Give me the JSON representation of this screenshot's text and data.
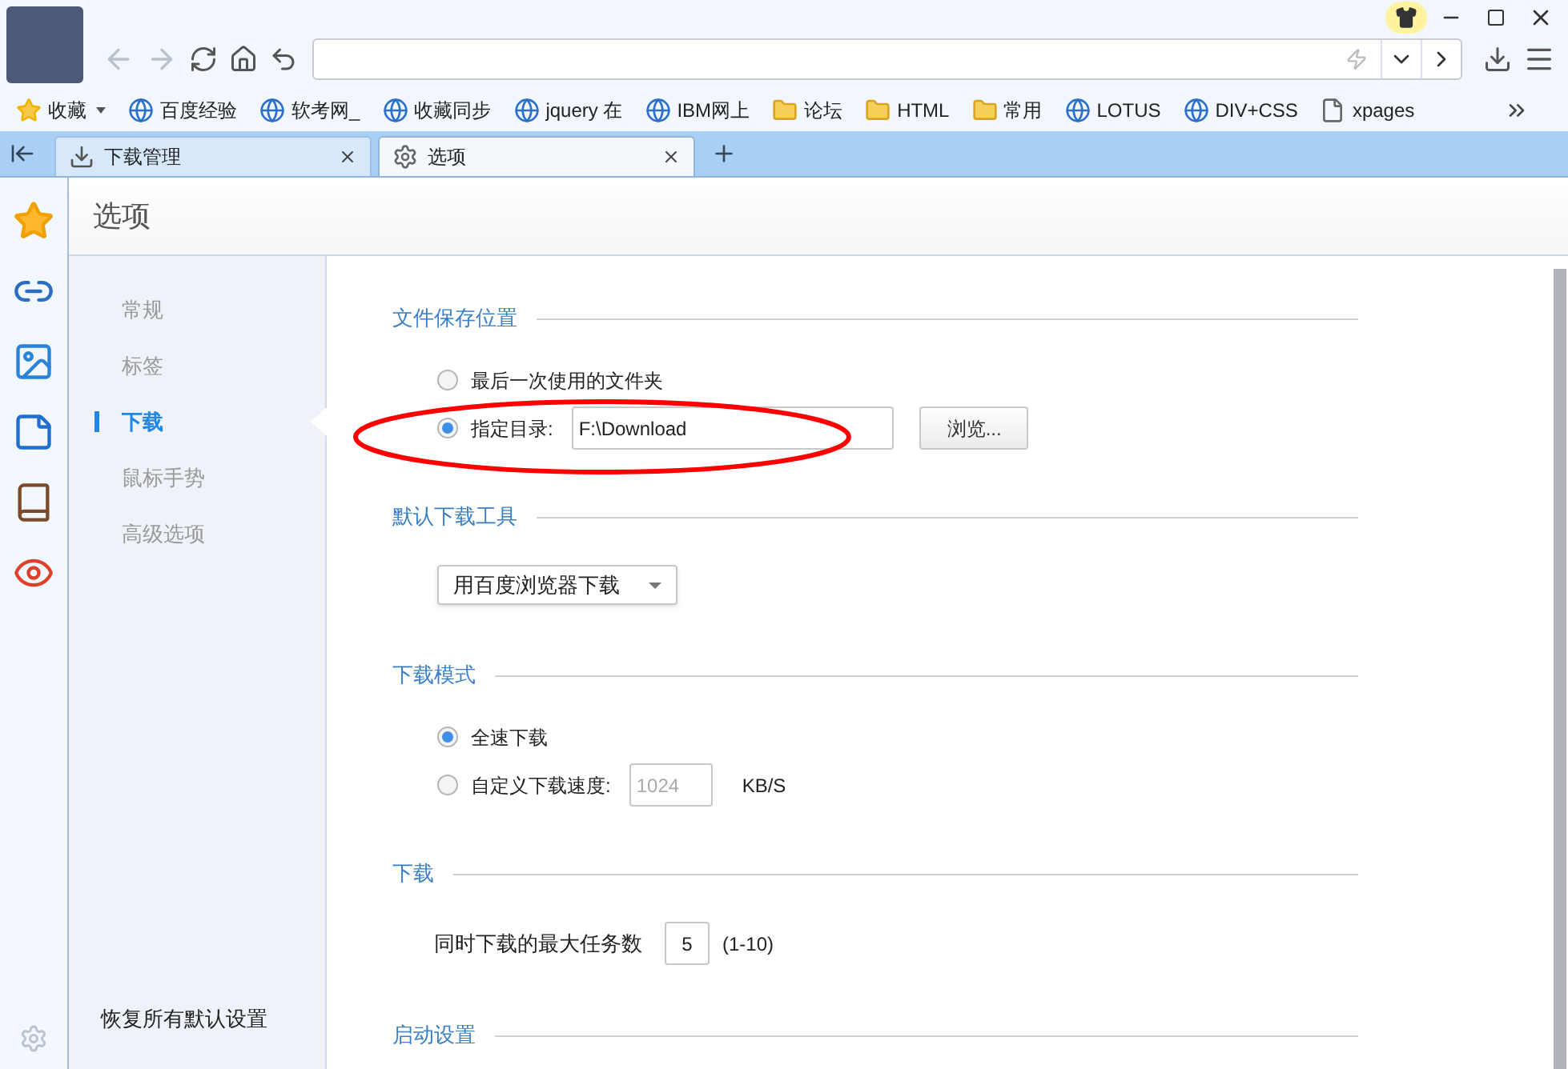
{
  "bookmarks": [
    {
      "label": "收藏",
      "kind": "menu"
    },
    {
      "label": "百度经验",
      "kind": "site"
    },
    {
      "label": "软考网_",
      "kind": "site"
    },
    {
      "label": "收藏同步",
      "kind": "site"
    },
    {
      "label": "jquery 在",
      "kind": "site"
    },
    {
      "label": "IBM网上",
      "kind": "site"
    },
    {
      "label": "论坛",
      "kind": "folder"
    },
    {
      "label": "HTML",
      "kind": "folder"
    },
    {
      "label": "常用",
      "kind": "folder"
    },
    {
      "label": "LOTUS",
      "kind": "site"
    },
    {
      "label": "DIV+CSS",
      "kind": "site"
    },
    {
      "label": "xpages",
      "kind": "page"
    }
  ],
  "tabs": [
    {
      "label": "下载管理",
      "selected": false
    },
    {
      "label": "选项",
      "selected": true
    }
  ],
  "page_title": "选项",
  "nav": [
    {
      "label": "常规",
      "selected": false
    },
    {
      "label": "标签",
      "selected": false
    },
    {
      "label": "下载",
      "selected": true
    },
    {
      "label": "鼠标手势",
      "selected": false
    },
    {
      "label": "高级选项",
      "selected": false
    }
  ],
  "reset_link": "恢复所有默认设置",
  "sections": [
    {
      "kind": "radios",
      "title": "文件保存位置",
      "options": [
        {
          "label": "最后一次使用的文件夹",
          "selected": false
        },
        {
          "label": "指定目录:",
          "selected": true,
          "field": "F:\\Download",
          "button": "浏览..."
        }
      ]
    },
    {
      "kind": "dropdown",
      "title": "默认下载工具",
      "value": "用百度浏览器下载"
    },
    {
      "kind": "radios",
      "title": "下载模式",
      "options": [
        {
          "label": "全速下载",
          "selected": true
        },
        {
          "label": "自定义下载速度:",
          "selected": false,
          "field": "1024",
          "unit": "KB/S"
        }
      ]
    },
    {
      "kind": "number",
      "title": "下载",
      "label": "同时下载的最大任务数",
      "value": "5",
      "hint": "(1-10)"
    },
    {
      "kind": "heading",
      "title": "启动设置"
    }
  ]
}
